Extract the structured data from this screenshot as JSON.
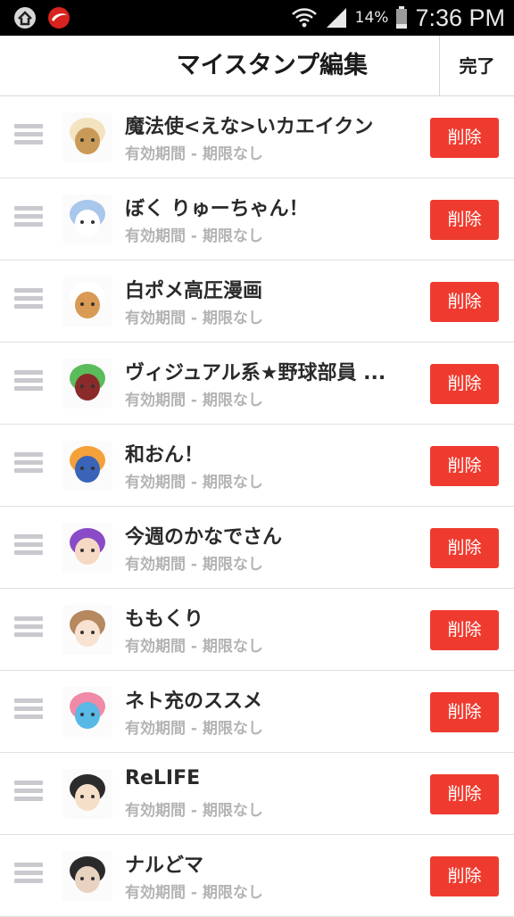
{
  "status_bar": {
    "battery_percent": "14%",
    "time": "7:36 PM",
    "icons": [
      "app-badge-icon",
      "trend-micro-icon",
      "wifi-icon",
      "signal-icon",
      "battery-icon"
    ]
  },
  "header": {
    "title": "マイスタンプ編集",
    "done_label": "完了"
  },
  "colors": {
    "delete_button": "#ef3b2f",
    "status_bar": "#000000",
    "subtitle_text": "#b4b4b4"
  },
  "stamps": [
    {
      "name": "魔法使<えな>いカエイクン",
      "validity": "有効期間 - 期限なし",
      "delete_label": "削除",
      "thumb_colors": [
        "#f3e3bf",
        "#c99a57"
      ]
    },
    {
      "name": "ぼく りゅーちゃん！",
      "validity": "有効期間 - 期限なし",
      "delete_label": "削除",
      "thumb_colors": [
        "#a9c6ec",
        "#ffffff"
      ]
    },
    {
      "name": "白ポメ高圧漫画",
      "validity": "有効期間 - 期限なし",
      "delete_label": "削除",
      "thumb_colors": [
        "#ffffff",
        "#d99a55"
      ]
    },
    {
      "name": "ヴィジュアル系★野球部員 ...",
      "validity": "有効期間 - 期限なし",
      "delete_label": "削除",
      "thumb_colors": [
        "#5bbc5b",
        "#8a2a2a"
      ]
    },
    {
      "name": "和おん！",
      "validity": "有効期間 - 期限なし",
      "delete_label": "削除",
      "thumb_colors": [
        "#f5a13a",
        "#3a64b8"
      ]
    },
    {
      "name": "今週のかなでさん",
      "validity": "有効期間 - 期限なし",
      "delete_label": "削除",
      "thumb_colors": [
        "#8a4bc8",
        "#f6d9c4"
      ]
    },
    {
      "name": "ももくり",
      "validity": "有効期間 - 期限なし",
      "delete_label": "削除",
      "thumb_colors": [
        "#b58860",
        "#f8e3d2"
      ]
    },
    {
      "name": "ネト充のススメ",
      "validity": "有効期間 - 期限なし",
      "delete_label": "削除",
      "thumb_colors": [
        "#f08aa8",
        "#58b8e6"
      ]
    },
    {
      "name": "ReLIFE",
      "validity": "有効期間 - 期限なし",
      "delete_label": "削除",
      "thumb_colors": [
        "#2b2b2b",
        "#f6dfc8"
      ]
    },
    {
      "name": "ナルどマ",
      "validity": "有効期間 - 期限なし",
      "delete_label": "削除",
      "thumb_colors": [
        "#2a2a2a",
        "#e8d3c0"
      ]
    }
  ]
}
